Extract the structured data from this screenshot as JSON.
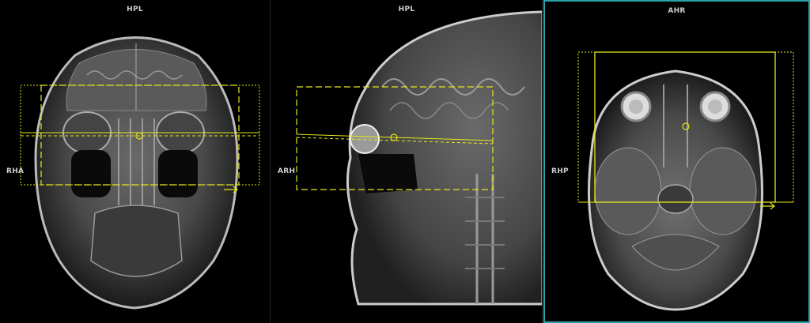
{
  "viewports": {
    "coronal": {
      "top_label": "HPL",
      "left_label": "RHA"
    },
    "sagittal": {
      "top_label": "HPL",
      "left_label": "ARH"
    },
    "axial": {
      "top_label": "AHR",
      "left_label": "RHP",
      "active": true
    }
  },
  "colors": {
    "background": "#000000",
    "overlay": "#e6e619",
    "active_border": "#2aa3a8",
    "label": "#cfcfcf"
  }
}
